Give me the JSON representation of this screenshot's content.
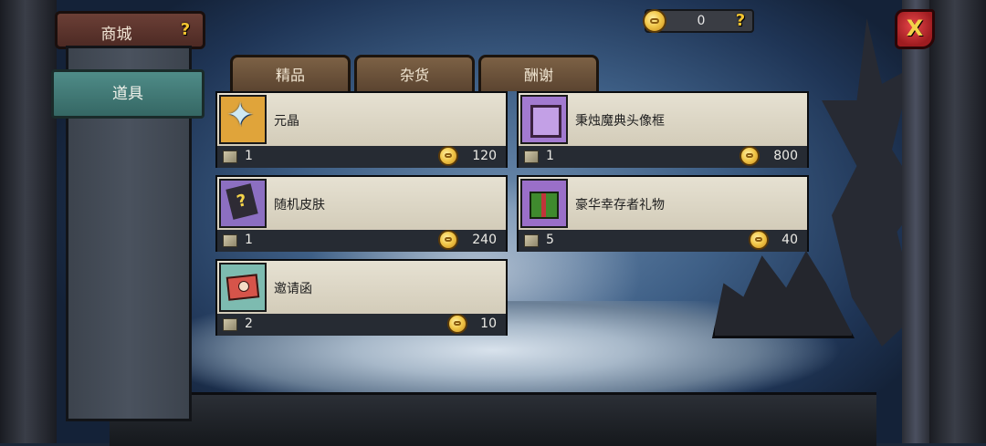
{
  "shop": {
    "title": "商城",
    "help": "?"
  },
  "sidebar": {
    "category": "道具"
  },
  "currency": {
    "value": "0",
    "help": "?"
  },
  "close": {
    "label": "X"
  },
  "tabs": [
    {
      "label": "精品"
    },
    {
      "label": "杂货"
    },
    {
      "label": "酬谢"
    }
  ],
  "items": [
    {
      "name": "元晶",
      "icon": "crystal-icon",
      "qty": "1",
      "price": "120"
    },
    {
      "name": "秉烛魔典头像框",
      "icon": "avatar-frame-icon",
      "qty": "1",
      "price": "800"
    },
    {
      "name": "随机皮肤",
      "icon": "mystery-book-icon",
      "qty": "1",
      "price": "240"
    },
    {
      "name": "豪华幸存者礼物",
      "icon": "gift-box-icon",
      "qty": "5",
      "price": "40"
    },
    {
      "name": "邀请函",
      "icon": "invitation-letter-icon",
      "qty": "2",
      "price": "10"
    }
  ],
  "colors": {
    "category_tab": "#4f8c88",
    "shop_title": "#6b3f36",
    "tab": "#7c6145",
    "coin": "#f2c84b",
    "close": "#c2343a"
  }
}
